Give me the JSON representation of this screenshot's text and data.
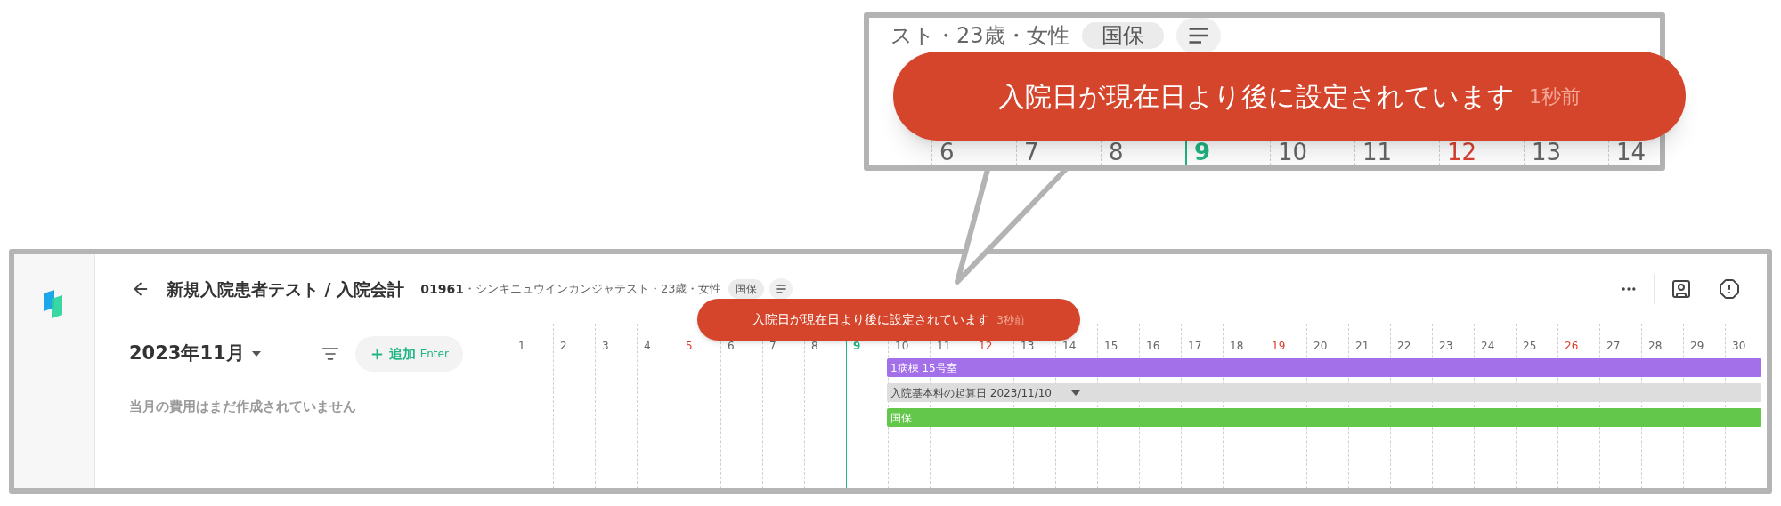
{
  "callout": {
    "patient_info": "スト・23歳・女性",
    "insurance_chip": "国保",
    "toast": {
      "message": "入院日が現在日より後に設定されています",
      "time": "1秒前"
    },
    "days": [
      {
        "label": "6",
        "kind": "weekday"
      },
      {
        "label": "7",
        "kind": "weekday"
      },
      {
        "label": "8",
        "kind": "weekday"
      },
      {
        "label": "9",
        "kind": "today"
      },
      {
        "label": "10",
        "kind": "weekday"
      },
      {
        "label": "11",
        "kind": "weekday"
      },
      {
        "label": "12",
        "kind": "sunday"
      },
      {
        "label": "13",
        "kind": "weekday"
      },
      {
        "label": "14",
        "kind": "weekday"
      }
    ]
  },
  "header": {
    "title": "新規入院患者テスト / 入院会計",
    "patient_id": "01961",
    "patient_info": "・シンキニュウインカンジャテスト・23歳・女性",
    "insurance_chip": "国保"
  },
  "toast": {
    "message": "入院日が現在日より後に設定されています",
    "time": "3秒前"
  },
  "month": "2023年11月",
  "add_button": {
    "label": "追加",
    "shortcut": "Enter"
  },
  "empty_message": "当月の費用はまだ作成されていません",
  "timeline": {
    "days": [
      {
        "label": "1",
        "kind": "weekday"
      },
      {
        "label": "2",
        "kind": "weekday"
      },
      {
        "label": "3",
        "kind": "weekday"
      },
      {
        "label": "4",
        "kind": "weekday"
      },
      {
        "label": "5",
        "kind": "sunday"
      },
      {
        "label": "6",
        "kind": "weekday"
      },
      {
        "label": "7",
        "kind": "weekday"
      },
      {
        "label": "8",
        "kind": "weekday"
      },
      {
        "label": "9",
        "kind": "today"
      },
      {
        "label": "10",
        "kind": "weekday"
      },
      {
        "label": "11",
        "kind": "weekday"
      },
      {
        "label": "12",
        "kind": "sunday"
      },
      {
        "label": "13",
        "kind": "weekday"
      },
      {
        "label": "14",
        "kind": "weekday"
      },
      {
        "label": "15",
        "kind": "weekday"
      },
      {
        "label": "16",
        "kind": "weekday"
      },
      {
        "label": "17",
        "kind": "weekday"
      },
      {
        "label": "18",
        "kind": "weekday"
      },
      {
        "label": "19",
        "kind": "sunday"
      },
      {
        "label": "20",
        "kind": "weekday"
      },
      {
        "label": "21",
        "kind": "weekday"
      },
      {
        "label": "22",
        "kind": "weekday"
      },
      {
        "label": "23",
        "kind": "weekday"
      },
      {
        "label": "24",
        "kind": "weekday"
      },
      {
        "label": "25",
        "kind": "weekday"
      },
      {
        "label": "26",
        "kind": "sunday"
      },
      {
        "label": "27",
        "kind": "weekday"
      },
      {
        "label": "28",
        "kind": "weekday"
      },
      {
        "label": "29",
        "kind": "weekday"
      },
      {
        "label": "30",
        "kind": "weekday"
      }
    ],
    "bars": [
      {
        "label": "1病棟 15号室",
        "kind": "plain",
        "color": "#a470ea"
      },
      {
        "label": "入院基本料の起算日 2023/11/10",
        "kind": "dropdown",
        "color": "#dddddd"
      },
      {
        "label": "国保",
        "kind": "plain",
        "color": "#62c74a"
      }
    ]
  }
}
